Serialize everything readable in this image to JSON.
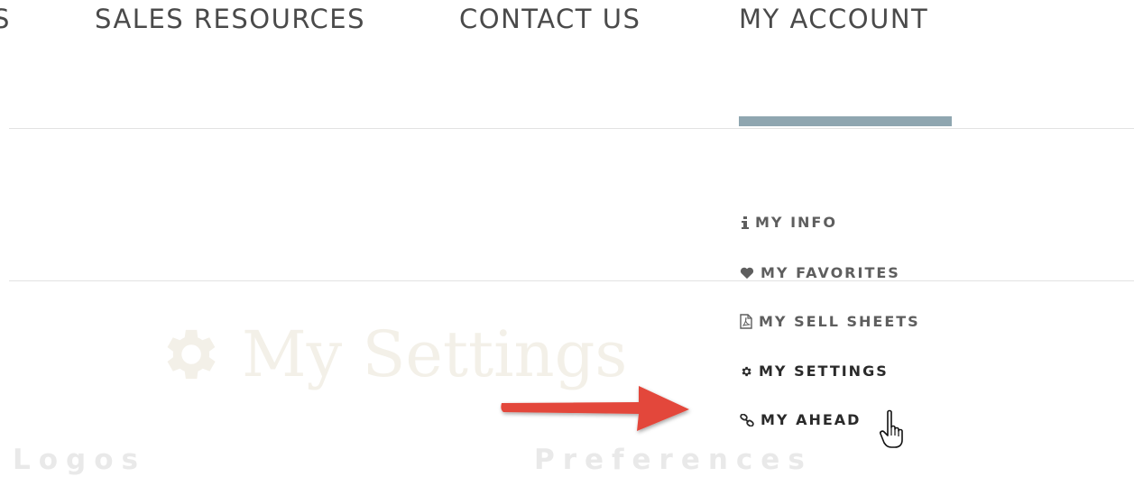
{
  "nav": {
    "partial_label": "S",
    "items": [
      {
        "label": "SALES RESOURCES"
      },
      {
        "label": "CONTACT US"
      },
      {
        "label": "MY ACCOUNT"
      }
    ]
  },
  "dropdown": {
    "items": [
      {
        "icon": "info-icon",
        "label": "MY INFO"
      },
      {
        "icon": "heart-icon",
        "label": "MY FAVORITES"
      },
      {
        "icon": "pdf-file-icon",
        "label": "MY SELL SHEETS"
      },
      {
        "icon": "gear-icon",
        "label": "MY SETTINGS"
      },
      {
        "icon": "link-icon",
        "label": "MY AHEAD"
      }
    ]
  },
  "page": {
    "heading": "My Settings",
    "sections": [
      "Logos",
      "Preferences"
    ]
  },
  "colors": {
    "active_underline": "#8fa6b0",
    "annotation_arrow": "#e3473b",
    "nav_text": "#4a4a4a"
  }
}
